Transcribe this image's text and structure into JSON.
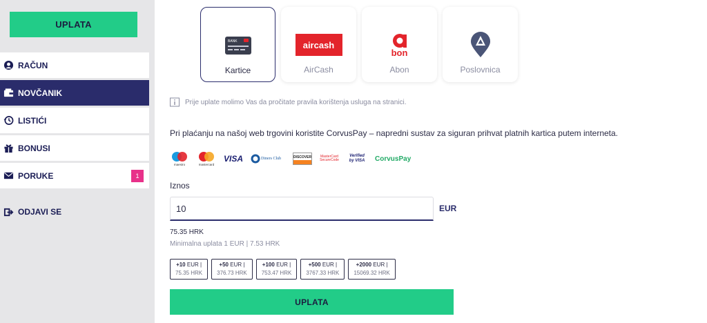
{
  "sidebar": {
    "deposit_button": "UPLATA",
    "items": [
      {
        "label": "RAČUN",
        "icon": "user-icon"
      },
      {
        "label": "NOVČANIK",
        "icon": "wallet-icon"
      },
      {
        "label": "LISTIĆI",
        "icon": "history-icon"
      },
      {
        "label": "BONUSI",
        "icon": "gift-icon"
      },
      {
        "label": "PORUKE",
        "icon": "mail-icon",
        "badge": "1"
      }
    ],
    "logout": "ODJAVI SE"
  },
  "methods": [
    {
      "label": "Kartice",
      "selected": true
    },
    {
      "label": "AirCash",
      "logo_text": "aircash"
    },
    {
      "label": "Abon",
      "logo_text": "bon"
    },
    {
      "label": "Poslovnica"
    }
  ],
  "card_logo_text": "BANK",
  "notice": "Prije uplate molimo Vas da pročitate pravila korištenja usluga na stranici.",
  "intro": {
    "before": "Pri plaćanju na našoj web trgovini koristite ",
    "brand": "CorvusPay",
    "after": " – napredni sustav za siguran prihvat platnih kartica putem interneta."
  },
  "card_brands": [
    "maestro",
    "mastercard",
    "VISA",
    "Diners Club",
    "DISCOVER",
    "MasterCard SecureCode",
    "Verified by VISA",
    "CorvusPay"
  ],
  "amount": {
    "label": "Iznos",
    "value": "10",
    "currency": "EUR",
    "converted": "75.35 HRK",
    "minimum": "Minimalna uplata 1 EUR | 7.53 HRK"
  },
  "quick_amounts": [
    {
      "eur": "+10",
      "unit": "EUR |",
      "hrk": "75.35 HRK"
    },
    {
      "eur": "+50",
      "unit": "EUR |",
      "hrk": "376.73 HRK"
    },
    {
      "eur": "+100",
      "unit": "EUR |",
      "hrk": "753.47 HRK"
    },
    {
      "eur": "+500",
      "unit": "EUR |",
      "hrk": "3767.33 HRK"
    },
    {
      "eur": "+2000",
      "unit": "EUR |",
      "hrk": "15069.32 HRK"
    }
  ],
  "submit": "UPLATA",
  "colors": {
    "accent_green": "#22cc88",
    "navy": "#2a2c6b",
    "badge_pink": "#e8318a",
    "aircash_red": "#e3242b"
  }
}
